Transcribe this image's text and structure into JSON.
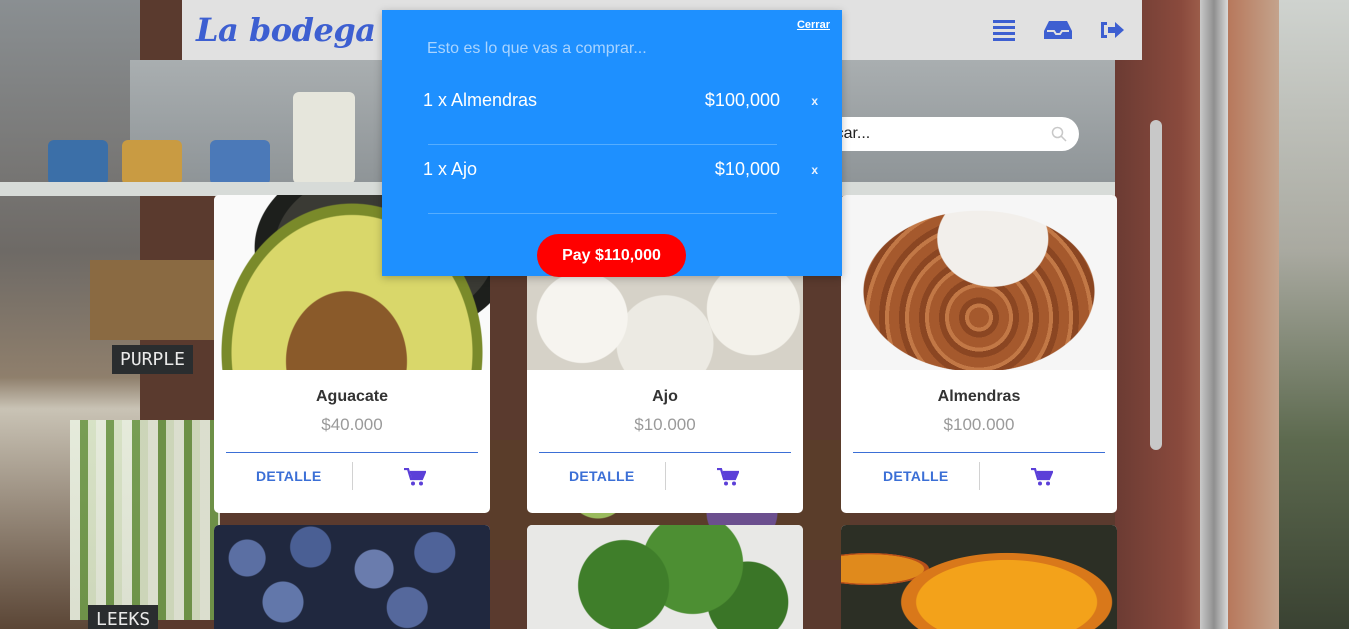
{
  "header": {
    "logo": "La bodega",
    "icons": [
      "list-icon",
      "inbox-icon",
      "logout-icon"
    ]
  },
  "search": {
    "placeholder": "Buscar..."
  },
  "cart": {
    "close_label": "Cerrar",
    "lead": "Esto es lo que vas a comprar...",
    "items": [
      {
        "label": "1 x Almendras",
        "amount": "$100,000",
        "remove": "x"
      },
      {
        "label": "1 x Ajo",
        "amount": "$10,000",
        "remove": "x"
      }
    ],
    "pay_label": "Pay $110,000"
  },
  "products": [
    {
      "name": "Aguacate",
      "price": "$40.000",
      "detail": "DETALLE"
    },
    {
      "name": "Ajo",
      "price": "$10.000",
      "detail": "DETALLE"
    },
    {
      "name": "Almendras",
      "price": "$100.000",
      "detail": "DETALLE"
    }
  ],
  "colors": {
    "brand": "#3d5fd1",
    "cart_panel": "#1e90ff",
    "pay_button": "#ff0000",
    "cart_icon": "#5b3fd8"
  }
}
